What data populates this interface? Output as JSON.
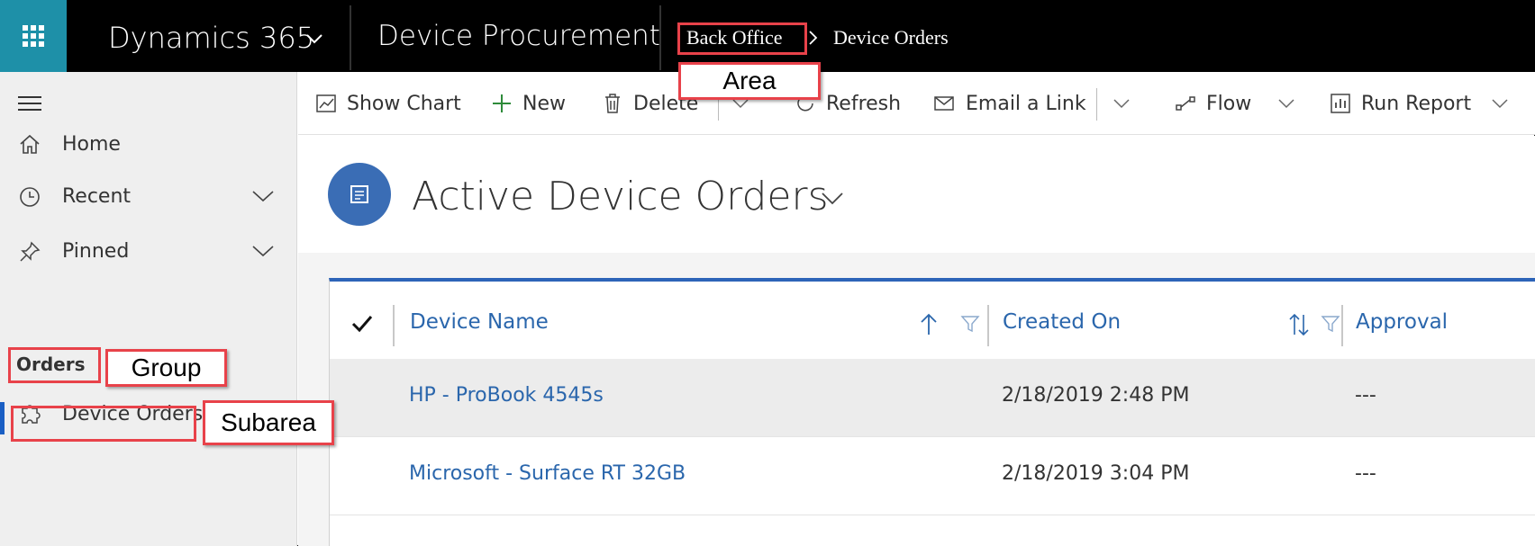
{
  "topbar": {
    "app_name": "Dynamics 365",
    "module_name": "Device Procurement",
    "breadcrumb_area": "Back Office",
    "breadcrumb_current": "Device Orders"
  },
  "annotations": {
    "area": "Area",
    "group": "Group",
    "subarea": "Subarea",
    "accent_color": "#e8424a"
  },
  "sidebar": {
    "items": [
      {
        "label": "Home",
        "icon": "home-icon"
      },
      {
        "label": "Recent",
        "icon": "clock-icon"
      },
      {
        "label": "Pinned",
        "icon": "pin-icon"
      }
    ],
    "group_label": "Orders",
    "subarea_label": "Device Orders"
  },
  "commands": {
    "show_chart": "Show Chart",
    "new": "New",
    "delete": "Delete",
    "refresh": "Refresh",
    "email_link": "Email a Link",
    "flow": "Flow",
    "run_report": "Run Report"
  },
  "view": {
    "title": "Active Device Orders",
    "icon_color": "#3a6db5"
  },
  "grid": {
    "columns": [
      "Device Name",
      "Created On",
      "Approval"
    ],
    "rows": [
      {
        "device_name": "HP - ProBook 4545s",
        "created_on": "2/18/2019 2:48 PM",
        "approval": "---"
      },
      {
        "device_name": "Microsoft - Surface RT 32GB",
        "created_on": "2/18/2019 3:04 PM",
        "approval": "---"
      }
    ],
    "header_accent": "#2d64b8"
  },
  "colors": {
    "topbar_bg": "#000000",
    "waffle_bg": "#1e90a8",
    "link": "#2a66ac"
  }
}
